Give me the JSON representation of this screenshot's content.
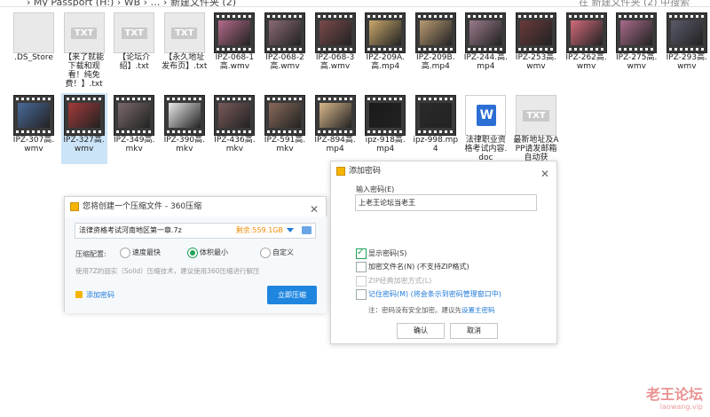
{
  "addressbar": {
    "path": "› My Passport (H:) › WB › … › 新建文件夹 (2)",
    "search_placeholder": "在 新建文件夹 (2) 中搜索"
  },
  "files_row1": [
    {
      "label": ".DS_Store",
      "kind": "doc"
    },
    {
      "label": "【来了就能下载和观看！纯免费！】.txt",
      "kind": "txt"
    },
    {
      "label": "【论坛介绍】.txt",
      "kind": "txt"
    },
    {
      "label": "【永久地址发布页】.txt",
      "kind": "txt"
    },
    {
      "label": "IPZ-068-1高.wmv",
      "kind": "video",
      "tint": "#b46a8a"
    },
    {
      "label": "IPZ-068-2高.wmv",
      "kind": "video",
      "tint": "#8a6a74"
    },
    {
      "label": "IPZ-068-3高.wmv",
      "kind": "video",
      "tint": "#7a4a4a"
    },
    {
      "label": "IPZ-209A.高.mp4",
      "kind": "video",
      "tint": "#c9a86a"
    },
    {
      "label": "IPZ-209B.高.mp4",
      "kind": "video",
      "tint": "#b89a72"
    },
    {
      "label": "IPZ-244.高.mp4",
      "kind": "video",
      "tint": "#9a7a8c"
    },
    {
      "label": "IPZ-253高.wmv",
      "kind": "video",
      "tint": "#6a3a3a"
    },
    {
      "label": "IPZ-262高.wmv",
      "kind": "video",
      "tint": "#d26a7a"
    },
    {
      "label": "IPZ-275高.wmv",
      "kind": "video",
      "tint": "#a86a8a"
    },
    {
      "label": "IPZ-293高.wmv",
      "kind": "video",
      "tint": "#5a5a6a"
    }
  ],
  "files_row2": [
    {
      "label": "IPZ-307高.wmv",
      "kind": "video",
      "tint": "#4a6a9a",
      "selected": false
    },
    {
      "label": "IPZ-327高.wmv",
      "kind": "video",
      "tint": "#a43a3a",
      "selected": true
    },
    {
      "label": "IPZ-349高.mkv",
      "kind": "video",
      "tint": "#7a6a6a",
      "selected": false
    },
    {
      "label": "IPZ-390高.mkv",
      "kind": "video",
      "tint": "#e8e8e8",
      "selected": false
    },
    {
      "label": "IPZ-436高.mkv",
      "kind": "video",
      "tint": "#7a5a5a",
      "selected": false
    },
    {
      "label": "IPZ-591高.mkv",
      "kind": "video",
      "tint": "#8a6a5a",
      "selected": false
    },
    {
      "label": "IPZ-894高.mp4",
      "kind": "video",
      "tint": "#d8b88a",
      "selected": false
    },
    {
      "label": "ipz-918高.mp4",
      "kind": "video",
      "tint": "#1a1a1a",
      "selected": false
    },
    {
      "label": "ipz-998.mp4",
      "kind": "video",
      "tint": "#2a2a2a",
      "selected": false
    },
    {
      "label": "法律职业资格考试内容.doc",
      "kind": "word",
      "selected": false
    },
    {
      "label": "最新地址及APP请发邮箱自动获",
      "kind": "txt",
      "selected": false
    }
  ],
  "compress_dialog": {
    "title": "您将创建一个压缩文件 - 360压缩",
    "filename": "法律资格考试河南地区第一章.7z",
    "remaining": "剩余:559.1GB",
    "config_label": "压缩配置:",
    "options": [
      "速度最快",
      "体积最小",
      "自定义"
    ],
    "selected_option": "体积最小",
    "hint": "使用7Z的固实（Solid）压缩技术，建议使用360压缩进行解压",
    "add_password": "添加密码",
    "start": "立即压缩"
  },
  "password_dialog": {
    "title": "添加密码",
    "input_label": "输入密码(E)",
    "password_value": "上老王论坛当老王",
    "checks": [
      {
        "label": "显示密码(S)",
        "checked": true,
        "disabled": false,
        "link": false
      },
      {
        "label": "加密文件名(N) (不支持ZIP格式)",
        "checked": false,
        "disabled": false,
        "link": false
      },
      {
        "label": "ZIP经典加密方式(L)",
        "checked": false,
        "disabled": true,
        "link": false
      },
      {
        "label": "记住密码(M) (将会条示到密码管理窗口中)",
        "checked": false,
        "disabled": false,
        "link": true
      }
    ],
    "note_prefix": "注：密码没有安全加密。建议先",
    "note_link": "设置主密码",
    "ok": "确认",
    "cancel": "取消"
  },
  "watermark": {
    "title": "老王论坛",
    "site": "laowang.vip"
  },
  "icons": [
    "txt-icon",
    "video-icon",
    "word-icon",
    "doc-icon",
    "folder-icon",
    "lock-icon",
    "close-icon"
  ]
}
